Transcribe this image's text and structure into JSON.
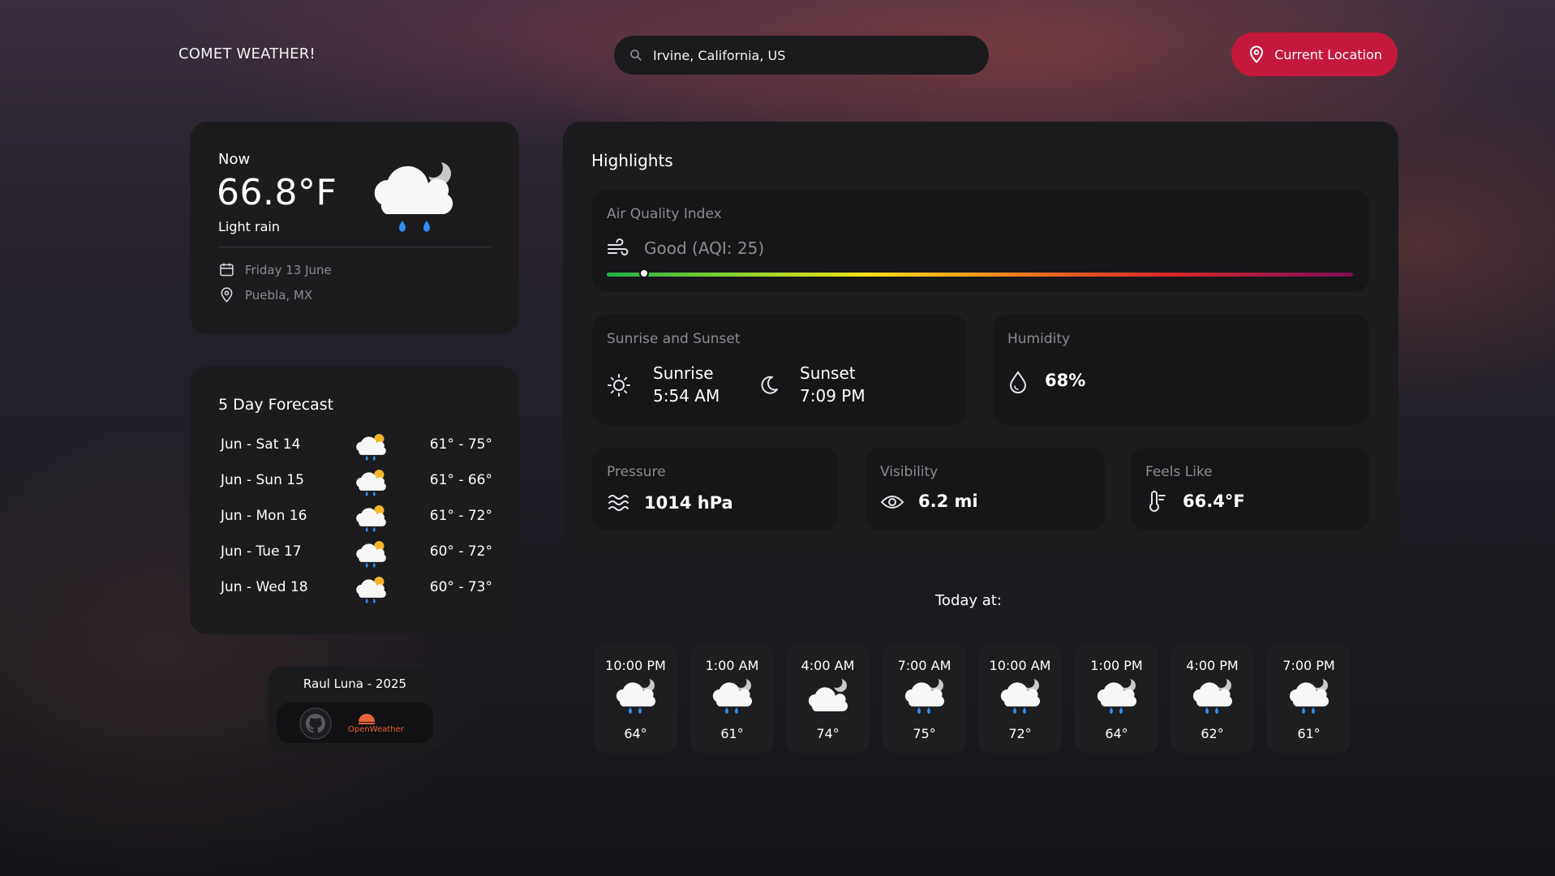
{
  "header": {
    "brand": "COMET WEATHER!",
    "search_value": "Irvine, California, US",
    "location_button": "Current Location"
  },
  "current": {
    "label": "Now",
    "temp": "66.8°F",
    "description": "Light rain",
    "date": "Friday 13 June",
    "location": "Puebla, MX",
    "icon": "cloud-moon-rain-icon"
  },
  "forecast": {
    "title": "5 Day Forecast",
    "days": [
      {
        "day": "Jun - Sat 14",
        "range": "61° - 75°",
        "icon": "cloud-sun-rain-icon"
      },
      {
        "day": "Jun - Sun 15",
        "range": "61° - 66°",
        "icon": "cloud-sun-rain-icon"
      },
      {
        "day": "Jun - Mon 16",
        "range": "61° - 72°",
        "icon": "cloud-sun-rain-icon"
      },
      {
        "day": "Jun - Tue 17",
        "range": "60° - 72°",
        "icon": "cloud-sun-rain-icon"
      },
      {
        "day": "Jun - Wed 18",
        "range": "60° - 73°",
        "icon": "cloud-sun-rain-icon"
      }
    ]
  },
  "credits": {
    "name": "Raul Luna - 2025",
    "openweather": "OpenWeather"
  },
  "highlights": {
    "title": "Highlights",
    "aqi": {
      "label": "Air Quality Index",
      "value": "Good (AQI: 25)",
      "level": 0.05
    },
    "sun": {
      "label": "Sunrise and Sunset",
      "sunrise_label": "Sunrise",
      "sunrise": "5:54 AM",
      "sunset_label": "Sunset",
      "sunset": "7:09 PM"
    },
    "humidity": {
      "label": "Humidity",
      "value": "68%"
    },
    "pressure": {
      "label": "Pressure",
      "value": "1014 hPa"
    },
    "visibility": {
      "label": "Visibility",
      "value": "6.2 mi"
    },
    "feels_like": {
      "label": "Feels Like",
      "value": "66.4°F"
    }
  },
  "hourly": {
    "title": "Today at:",
    "items": [
      {
        "time": "10:00 PM",
        "temp": "64°",
        "icon": "cloud-moon-rain-icon"
      },
      {
        "time": "1:00 AM",
        "temp": "61°",
        "icon": "cloud-moon-rain-icon"
      },
      {
        "time": "4:00 AM",
        "temp": "74°",
        "icon": "cloud-moon-icon"
      },
      {
        "time": "7:00 AM",
        "temp": "75°",
        "icon": "cloud-moon-rain-icon"
      },
      {
        "time": "10:00 AM",
        "temp": "72°",
        "icon": "cloud-moon-rain-icon"
      },
      {
        "time": "1:00 PM",
        "temp": "64°",
        "icon": "cloud-moon-rain-icon"
      },
      {
        "time": "4:00 PM",
        "temp": "62°",
        "icon": "cloud-moon-rain-icon"
      },
      {
        "time": "7:00 PM",
        "temp": "61°",
        "icon": "cloud-moon-rain-icon"
      }
    ]
  },
  "colors": {
    "accent": "#c5183d",
    "card": "#1c1c1f",
    "subcard": "#161618",
    "rain": "#2f8ff0",
    "sun": "#f5b52a"
  }
}
